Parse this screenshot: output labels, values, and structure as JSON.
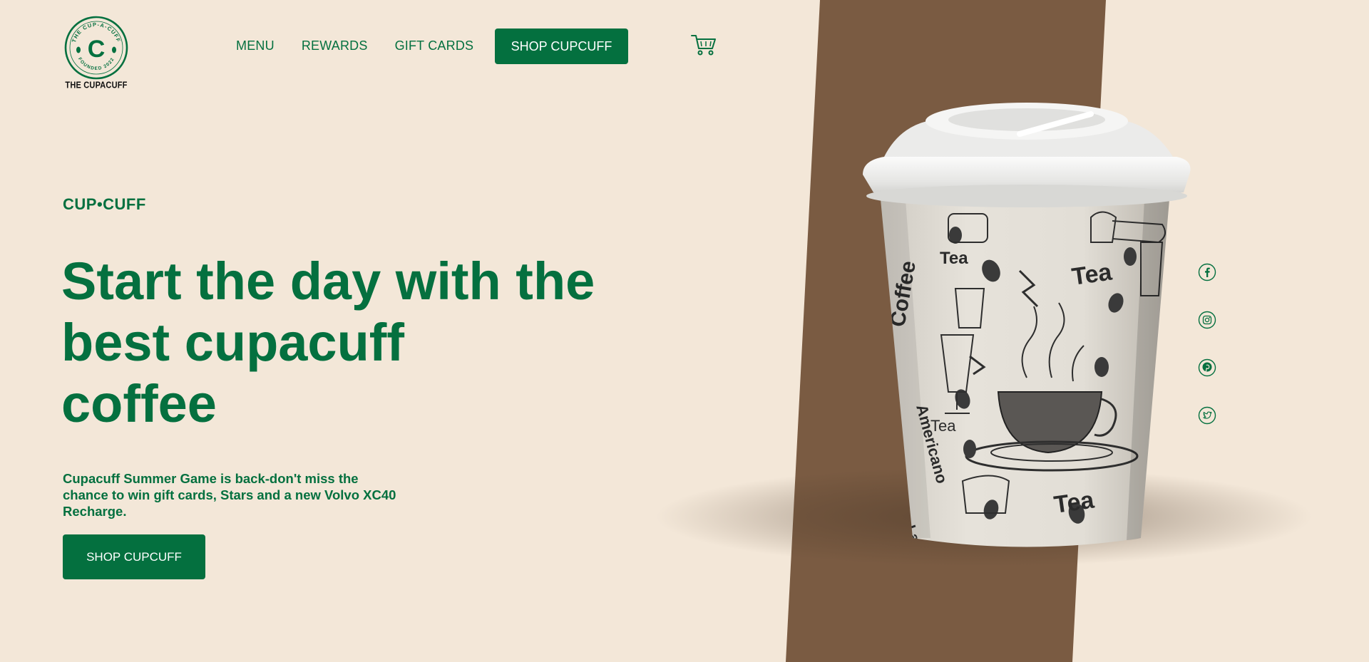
{
  "brand": {
    "logo_ring_text": "THE CUP-A-CUFF",
    "logo_founded_text": "FOUNDED 2022",
    "logo_letter": "C",
    "wordmark": "THE CUPACUFF"
  },
  "nav": {
    "items": [
      {
        "label": "MENU"
      },
      {
        "label": "REWARDS"
      },
      {
        "label": "GIFT CARDS"
      }
    ],
    "cta_label": "SHOP CUPCUFF",
    "cart_icon": "cart-icon"
  },
  "hero": {
    "eyebrow": "CUP•CUFF",
    "headline_line1": "Start the day with the",
    "headline_line2": "best cupacuff",
    "headline_line3": "coffee",
    "subtext": "Cupacuff Summer Game is back-don't miss the chance to win gift cards, Stars and a new Volvo XC40 Recharge.",
    "cta_label": "SHOP CUPCUFF"
  },
  "cup_image": {
    "sleeve_words": [
      "Coffee",
      "Tea",
      "Tea",
      "Tea",
      "Americano",
      "Tea",
      "Latte"
    ]
  },
  "social": [
    {
      "name": "facebook-icon"
    },
    {
      "name": "instagram-icon"
    },
    {
      "name": "pinterest-icon"
    },
    {
      "name": "twitter-icon"
    }
  ],
  "colors": {
    "background": "#f3e7d8",
    "brand_green": "#04703f",
    "stripe_brown": "#7a5b42"
  }
}
